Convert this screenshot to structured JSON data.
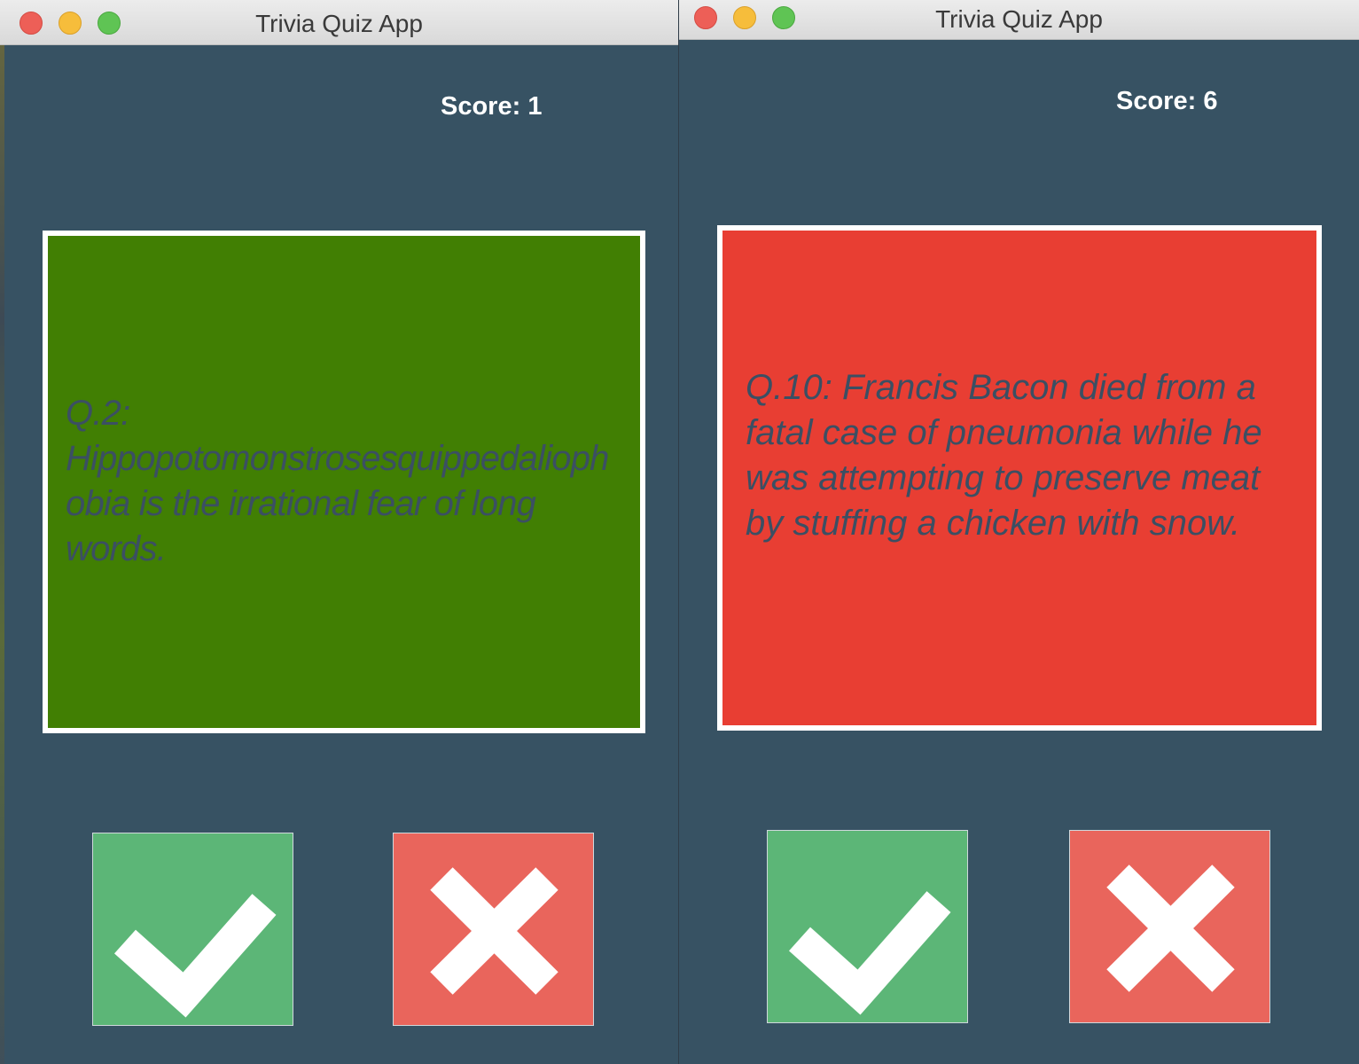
{
  "windows": [
    {
      "title": "Trivia Quiz App",
      "score": "Score: 1",
      "question": "Q.2: Hippopotomonstrosesquippedaliophobia is the irrational fear of long words.",
      "card_color": "#417f03",
      "true_button_icon": "checkmark-icon",
      "false_button_icon": "cross-icon"
    },
    {
      "title": "Trivia Quiz App",
      "score": "Score: 6",
      "question": "Q.10: Francis Bacon died from a fatal case of pneumonia while he was attempting to preserve meat by stuffing a chicken with snow.",
      "card_color": "#e83e33",
      "true_button_icon": "checkmark-icon",
      "false_button_icon": "cross-icon"
    }
  ],
  "colors": {
    "background": "#375263",
    "true_button": "#5cb677",
    "false_button": "#e9655c",
    "question_text": "#3b4f63"
  }
}
